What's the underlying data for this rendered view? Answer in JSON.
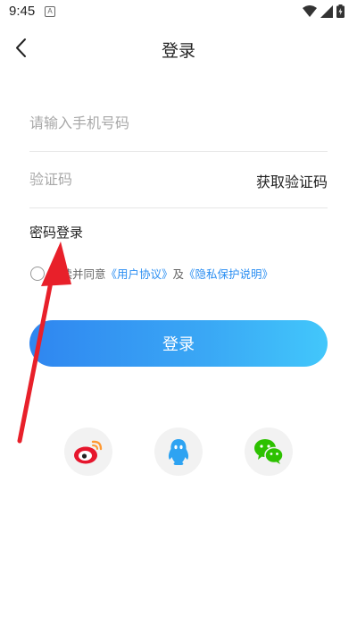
{
  "status_bar": {
    "time": "9:45",
    "app_badge": "A"
  },
  "header": {
    "title": "登录"
  },
  "form": {
    "phone_placeholder": "请输入手机号码",
    "code_placeholder": "验证码",
    "get_code_label": "获取验证码",
    "password_login_label": "密码登录"
  },
  "agreement": {
    "prefix": "阅读并同意",
    "user_agreement": "《用户协议》",
    "and": "及",
    "privacy_policy": "《隐私保护说明》"
  },
  "login_button": {
    "label": "登录"
  },
  "social_login": [
    {
      "name": "weibo",
      "icon": "weibo-icon"
    },
    {
      "name": "qq",
      "icon": "qq-icon"
    },
    {
      "name": "wechat",
      "icon": "wechat-icon"
    }
  ],
  "colors": {
    "accent": "#2a8ef2",
    "arrow": "#e8202a"
  }
}
